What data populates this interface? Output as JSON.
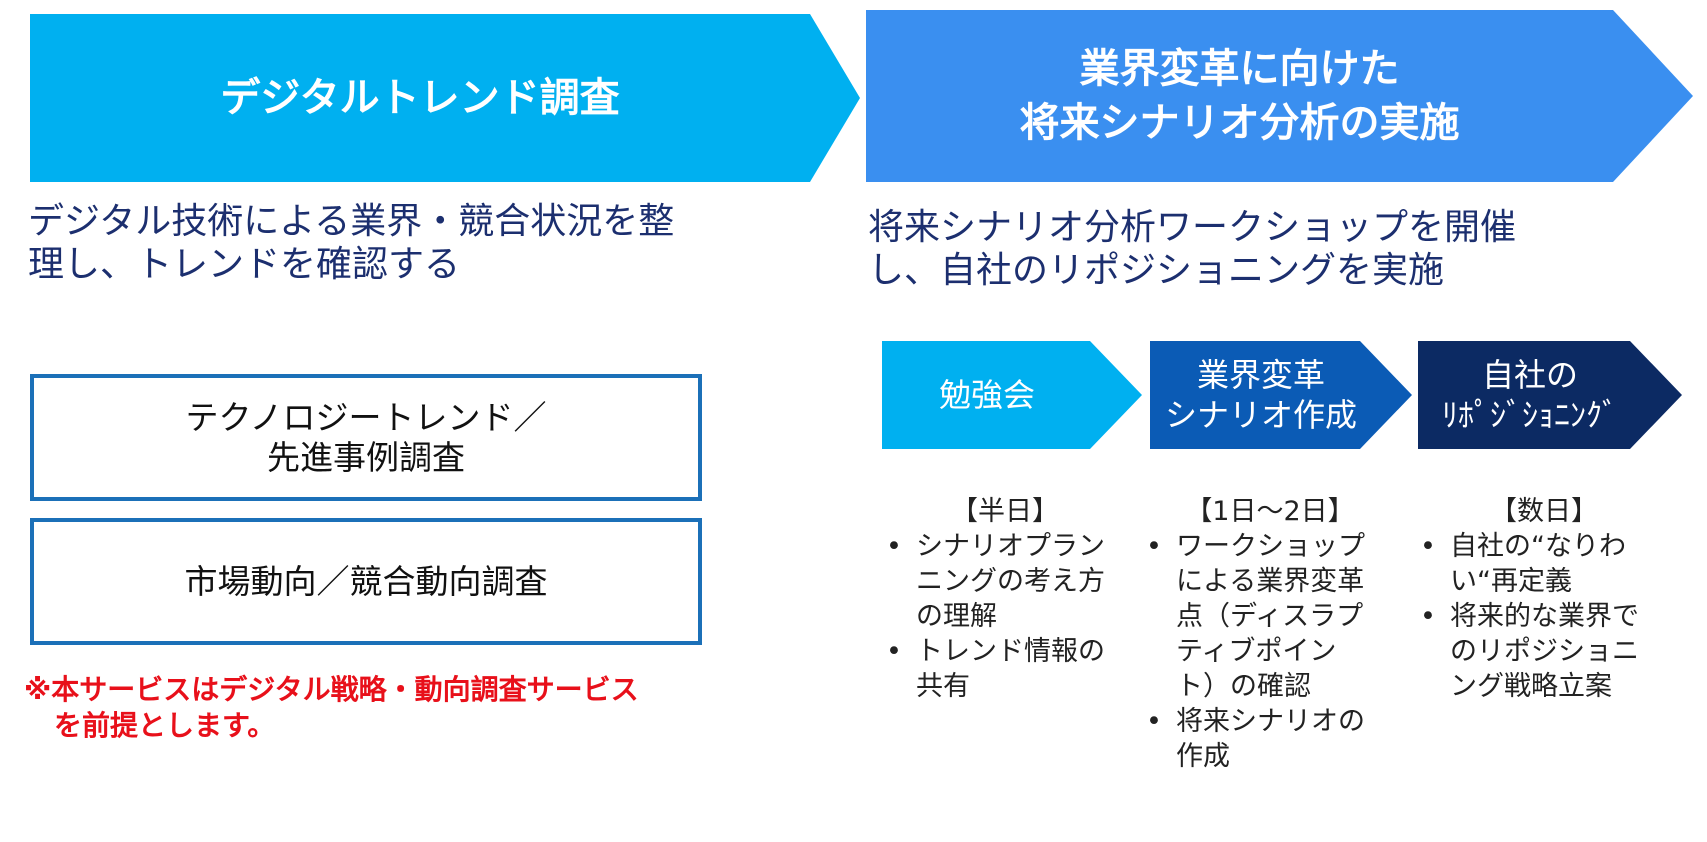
{
  "colors": {
    "arrow1": "#00b0f0",
    "arrow2": "#3a8ff0",
    "stage1": "#00b0f0",
    "stage2": "#0b5bb5",
    "stage3": "#0c2a63",
    "desc_text": "#1c2f6f",
    "note_text": "#e8101a",
    "box_border": "#1b70b8"
  },
  "left": {
    "arrow_title": "デジタルトレンド調査",
    "description_lines": [
      "デジタル技術による業界・競合状況を整",
      "理し、トレンドを確認する"
    ],
    "box1_lines": [
      "テクノロジートレンド／",
      "先進事例調査"
    ],
    "box2_label": "市場動向／競合動向調査",
    "note_lines": [
      "※本サービスはデジタル戦略・動向調査サービス",
      "を前提とします。"
    ]
  },
  "right": {
    "arrow_title_lines": [
      "業界変革に向けた",
      "将来シナリオ分析の実施"
    ],
    "description_lines": [
      "将来シナリオ分析ワークショップを開催",
      "し、自社のリポジショニングを実施"
    ],
    "stages": [
      {
        "label_lines": [
          "勉強会"
        ],
        "duration": "【半日】",
        "bullets": [
          [
            "シナリオプラン",
            "ニングの考え方",
            "の理解"
          ],
          [
            "トレンド情報の",
            "共有"
          ]
        ]
      },
      {
        "label_lines": [
          "業界変革",
          "シナリオ作成"
        ],
        "duration": "【1日～2日】",
        "bullets": [
          [
            "ワークショップ",
            "による業界変革",
            "点（ディスラプ",
            "ティブポイン",
            "ト）の確認"
          ],
          [
            "将来シナリオの",
            "作成"
          ]
        ]
      },
      {
        "label_lines": [
          "自社の",
          "ﾘﾎﾟｼﾞｼｮﾆﾝｸﾞ"
        ],
        "duration": "【数日】",
        "bullets": [
          [
            "自社の“なりわ",
            "い“再定義"
          ],
          [
            "将来的な業界で",
            "のリポジショニ",
            "ング戦略立案"
          ]
        ]
      }
    ],
    "bullet_char": "•"
  }
}
